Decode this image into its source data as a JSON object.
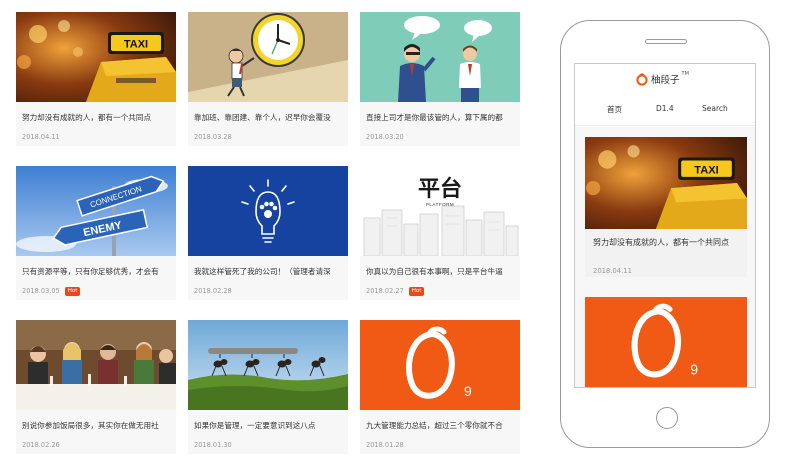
{
  "desktop_cards": [
    {
      "title": "努力却没有成就的人，都有一个共同点",
      "date": "2018.04.11",
      "badge": ""
    },
    {
      "title": "靠加班、靠团建、靠个人，迟早你会覆没",
      "date": "2018.03.28",
      "badge": ""
    },
    {
      "title": "直接上司才是你最该管的人，算下属的都",
      "date": "2018.03.20",
      "badge": ""
    },
    {
      "title": "只有资源平等，只有你足够优秀，才会有",
      "date": "2018.03.05",
      "badge": "Hot"
    },
    {
      "title": "我就这样管死了我的公司！（管理者请深",
      "date": "2018.02.28",
      "badge": ""
    },
    {
      "title": "你真以为自己很有本事啊，只是平台牛逼",
      "date": "2018.02.27",
      "badge": "Hot"
    },
    {
      "title": "别说你参加饭局很多，其实你在做无用社",
      "date": "2018.02.26",
      "badge": ""
    },
    {
      "title": "如果你是管理，一定要意识到这八点",
      "date": "2018.01.30",
      "badge": ""
    },
    {
      "title": "九大管理能力总结，超过三个零你就不合",
      "date": "2018.01.28",
      "badge": ""
    }
  ],
  "thumb_text": {
    "taxi": "TAXI",
    "connection": "CONNECTION",
    "enemy": "ENEMY",
    "platform_cn": "平台",
    "platform_en": "PLATFORM",
    "logo_num": "9"
  },
  "phone": {
    "logo_text": "柚段子",
    "logo_tm": "TM",
    "nav": [
      "首页",
      "D1.4",
      "Search"
    ],
    "feed": [
      {
        "title": "努力却没有成就的人，都有一个共同点",
        "date": "2018.04.11"
      }
    ]
  },
  "colors": {
    "accent_orange": "#f05a14",
    "hot_badge": "#e64a19",
    "card_bg": "#f7f7f7"
  }
}
